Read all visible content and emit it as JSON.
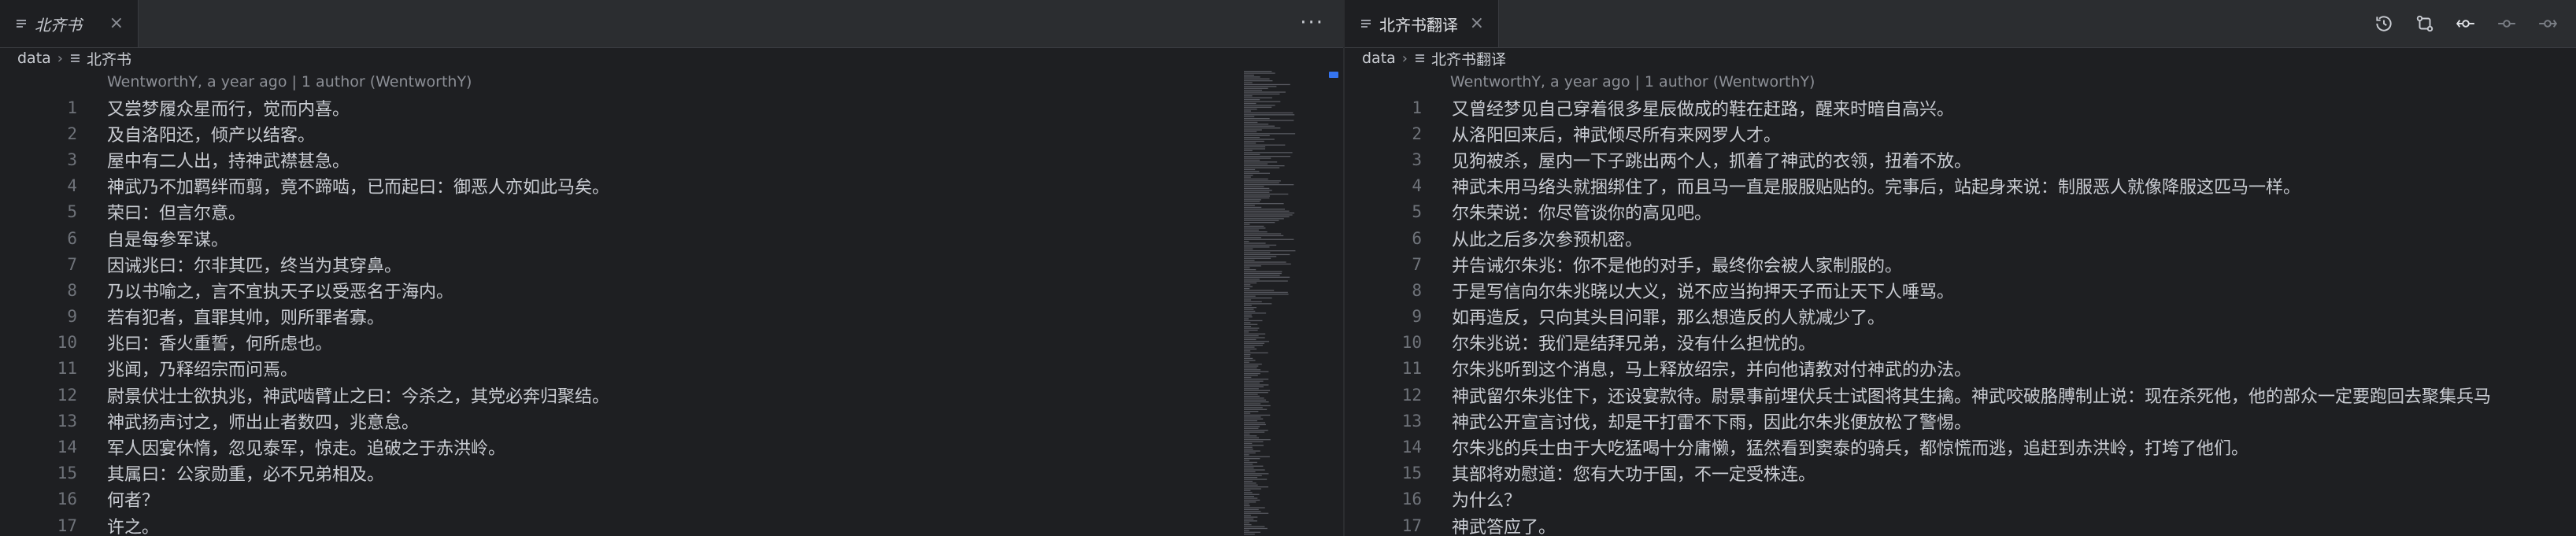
{
  "left_pane": {
    "tab_label": "北齐书",
    "tab_close": "×",
    "more_label": "···",
    "breadcrumb": [
      "data",
      "北齐书"
    ],
    "blame": "WentworthY, a year ago | 1 author (WentworthY)",
    "lines": [
      {
        "num": "1",
        "text": "又尝梦履众星而行，觉而内喜。"
      },
      {
        "num": "2",
        "text": "及自洛阳还，倾产以结客。"
      },
      {
        "num": "3",
        "text": "屋中有二人出，持神武襟甚急。"
      },
      {
        "num": "4",
        "text": "神武乃不加羁绊而翦，竟不蹄啮，已而起曰：御恶人亦如此马矣。"
      },
      {
        "num": "5",
        "text": "荣曰：但言尔意。"
      },
      {
        "num": "6",
        "text": "自是每参军谋。"
      },
      {
        "num": "7",
        "text": "因诫兆曰：尔非其匹，终当为其穿鼻。"
      },
      {
        "num": "8",
        "text": "乃以书喻之，言不宜执天子以受恶名于海内。"
      },
      {
        "num": "9",
        "text": "若有犯者，直罪其帅，则所罪者寡。"
      },
      {
        "num": "10",
        "text": "兆曰：香火重誓，何所虑也。"
      },
      {
        "num": "11",
        "text": "兆闻，乃释绍宗而问焉。"
      },
      {
        "num": "12",
        "text": "尉景伏壮士欲执兆，神武啮臂止之曰：今杀之，其党必奔归聚结。"
      },
      {
        "num": "13",
        "text": "神武扬声讨之，师出止者数四，兆意怠。"
      },
      {
        "num": "14",
        "text": "军人因宴休惰，忽见泰军，惊走。追破之于赤洪岭。"
      },
      {
        "num": "15",
        "text": "其属曰：公家勋重，必不兄弟相及。"
      },
      {
        "num": "16",
        "text": "何者？"
      },
      {
        "num": "17",
        "text": "许之。"
      }
    ]
  },
  "right_pane": {
    "tab_label": "北齐书翻译",
    "tab_close": "×",
    "breadcrumb": [
      "data",
      "北齐书翻译"
    ],
    "blame": "WentworthY, a year ago | 1 author (WentworthY)",
    "toolbar_icons": [
      "history-icon",
      "compare-changes-icon",
      "open-changes-icon",
      "previous-change-icon",
      "next-change-icon"
    ],
    "lines": [
      {
        "num": "1",
        "text": "又曾经梦见自己穿着很多星辰做成的鞋在赶路，醒来时暗自高兴。"
      },
      {
        "num": "2",
        "text": "从洛阳回来后，神武倾尽所有来网罗人才。"
      },
      {
        "num": "3",
        "text": "见狗被杀，屋内一下子跳出两个人，抓着了神武的衣领，扭着不放。"
      },
      {
        "num": "4",
        "text": "神武未用马络头就捆绑住了，而且马一直是服服贴贴的。完事后，站起身来说：制服恶人就像降服这匹马一样。"
      },
      {
        "num": "5",
        "text": "尔朱荣说：你尽管谈你的高见吧。"
      },
      {
        "num": "6",
        "text": "从此之后多次参预机密。"
      },
      {
        "num": "7",
        "text": "并告诫尔朱兆：你不是他的对手，最终你会被人家制服的。"
      },
      {
        "num": "8",
        "text": "于是写信向尔朱兆晓以大义，说不应当拘押天子而让天下人唾骂。"
      },
      {
        "num": "9",
        "text": "如再造反，只向其头目问罪，那么想造反的人就减少了。"
      },
      {
        "num": "10",
        "text": "尔朱兆说：我们是结拜兄弟，没有什么担忧的。"
      },
      {
        "num": "11",
        "text": "尔朱兆听到这个消息，马上释放绍宗，并向他请教对付神武的办法。"
      },
      {
        "num": "12",
        "text": "神武留尔朱兆住下，还设宴款待。尉景事前埋伏兵士试图将其生擒。神武咬破胳膊制止说：现在杀死他，他的部众一定要跑回去聚集兵马"
      },
      {
        "num": "13",
        "text": "神武公开宣言讨伐，却是干打雷不下雨，因此尔朱兆便放松了警惕。"
      },
      {
        "num": "14",
        "text": "尔朱兆的兵士由于大吃猛喝十分庸懒，猛然看到窦泰的骑兵，都惊慌而逃，追赶到赤洪岭，打垮了他们。"
      },
      {
        "num": "15",
        "text": "其部将劝慰道：您有大功于国，不一定受株连。"
      },
      {
        "num": "16",
        "text": "为什么？"
      },
      {
        "num": "17",
        "text": "神武答应了。"
      }
    ]
  },
  "colors": {
    "editor_bg": "#1e1f22",
    "tabbar_bg": "#2b2d30",
    "text": "#c9ccd2",
    "line_number": "#6f737a",
    "accent": "#3574f0"
  }
}
